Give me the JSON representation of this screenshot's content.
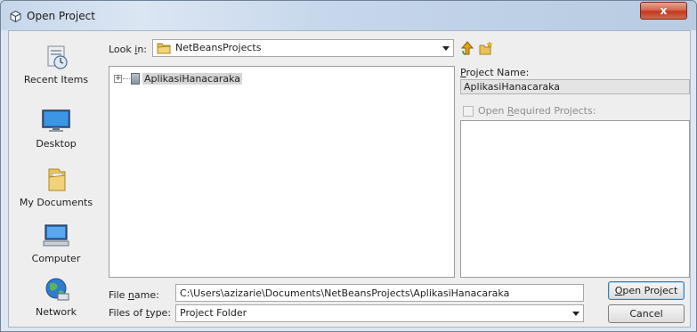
{
  "window": {
    "title": "Open Project",
    "close_glyph": "x"
  },
  "places": [
    {
      "label": "Recent Items",
      "icon": "recent-items-icon"
    },
    {
      "label": "Desktop",
      "icon": "desktop-icon"
    },
    {
      "label": "My Documents",
      "icon": "my-documents-icon"
    },
    {
      "label": "Computer",
      "icon": "computer-icon"
    },
    {
      "label": "Network",
      "icon": "network-icon"
    }
  ],
  "look_in": {
    "label_pre": "Look ",
    "label_key": "i",
    "label_post": "n:",
    "value": "NetBeansProjects"
  },
  "tree": {
    "items": [
      {
        "name": "AplikasiHanacaraka",
        "expander": "+"
      }
    ]
  },
  "project_name": {
    "label_key": "P",
    "label_rest": "roject Name:",
    "value": "AplikasiHanacaraka"
  },
  "open_required": {
    "label_pre": "Open ",
    "label_key": "R",
    "label_post": "equired Projects:",
    "checked": false,
    "enabled": false
  },
  "file_name": {
    "label_pre": "File ",
    "label_key": "n",
    "label_post": "ame:",
    "value": "C:\\Users\\azizarie\\Documents\\NetBeansProjects\\AplikasiHanacaraka"
  },
  "file_type": {
    "label_pre": "Files of ",
    "label_key": "t",
    "label_post": "ype:",
    "value": "Project Folder"
  },
  "buttons": {
    "open_key": "O",
    "open_rest": "pen Project",
    "cancel": "Cancel"
  },
  "colors": {
    "title_bar": "#c6d6ea",
    "close": "#c0391f",
    "folder": "#e8c35a",
    "selection": "#d5d5d5"
  }
}
